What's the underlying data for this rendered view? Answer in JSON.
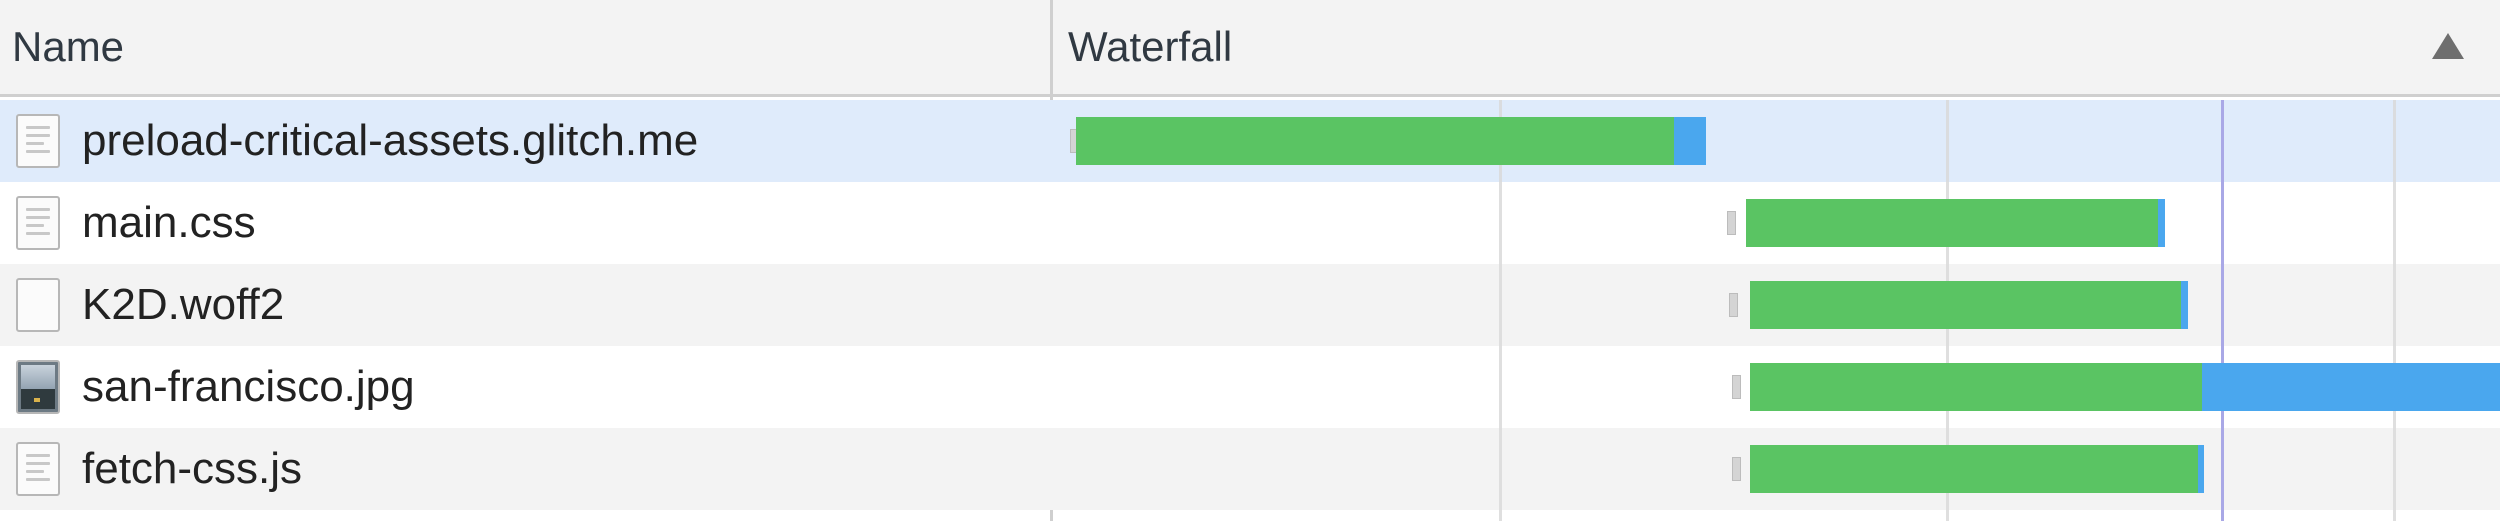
{
  "header": {
    "name_label": "Name",
    "waterfall_label": "Waterfall"
  },
  "colors": {
    "download": "#5ac463",
    "content_download": "#4aa7ee",
    "selected_row": "#dfebfb",
    "marker_line": "#a9a8e6"
  },
  "requests": [
    {
      "name": "preload-critical-assets.glitch.me",
      "icon": "document-icon",
      "selected": true
    },
    {
      "name": "main.css",
      "icon": "stylesheet-icon",
      "selected": false
    },
    {
      "name": "K2D.woff2",
      "icon": "font-file-icon",
      "selected": false
    },
    {
      "name": "san-francisco.jpg",
      "icon": "image-thumbnail-icon",
      "selected": false
    },
    {
      "name": "fetch-css.js",
      "icon": "script-icon",
      "selected": false
    }
  ]
}
